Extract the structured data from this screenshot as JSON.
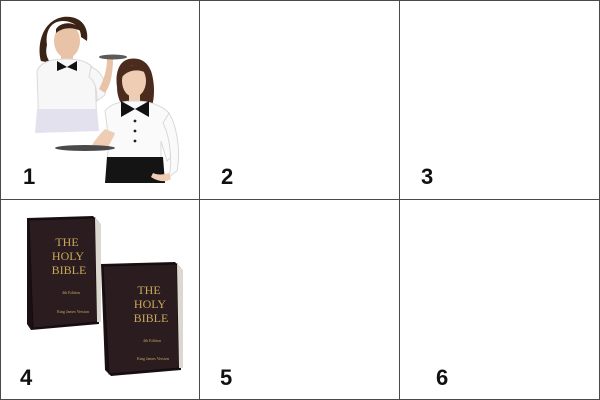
{
  "tiles": [
    {
      "number": "1",
      "content": "waitresses-image"
    },
    {
      "number": "2",
      "content": ""
    },
    {
      "number": "3",
      "content": ""
    },
    {
      "number": "4",
      "content": "holy-bible-books-image"
    },
    {
      "number": "5",
      "content": ""
    },
    {
      "number": "6",
      "content": ""
    }
  ],
  "bible": {
    "line1": "THE",
    "line2": "HOLY",
    "line3": "BIBLE",
    "edition": "4th Edition",
    "version": "King James Version"
  },
  "colors": {
    "grid_line": "#4a4a4a",
    "book_cover": "#2b1c20",
    "gold": "#c9a85a"
  }
}
